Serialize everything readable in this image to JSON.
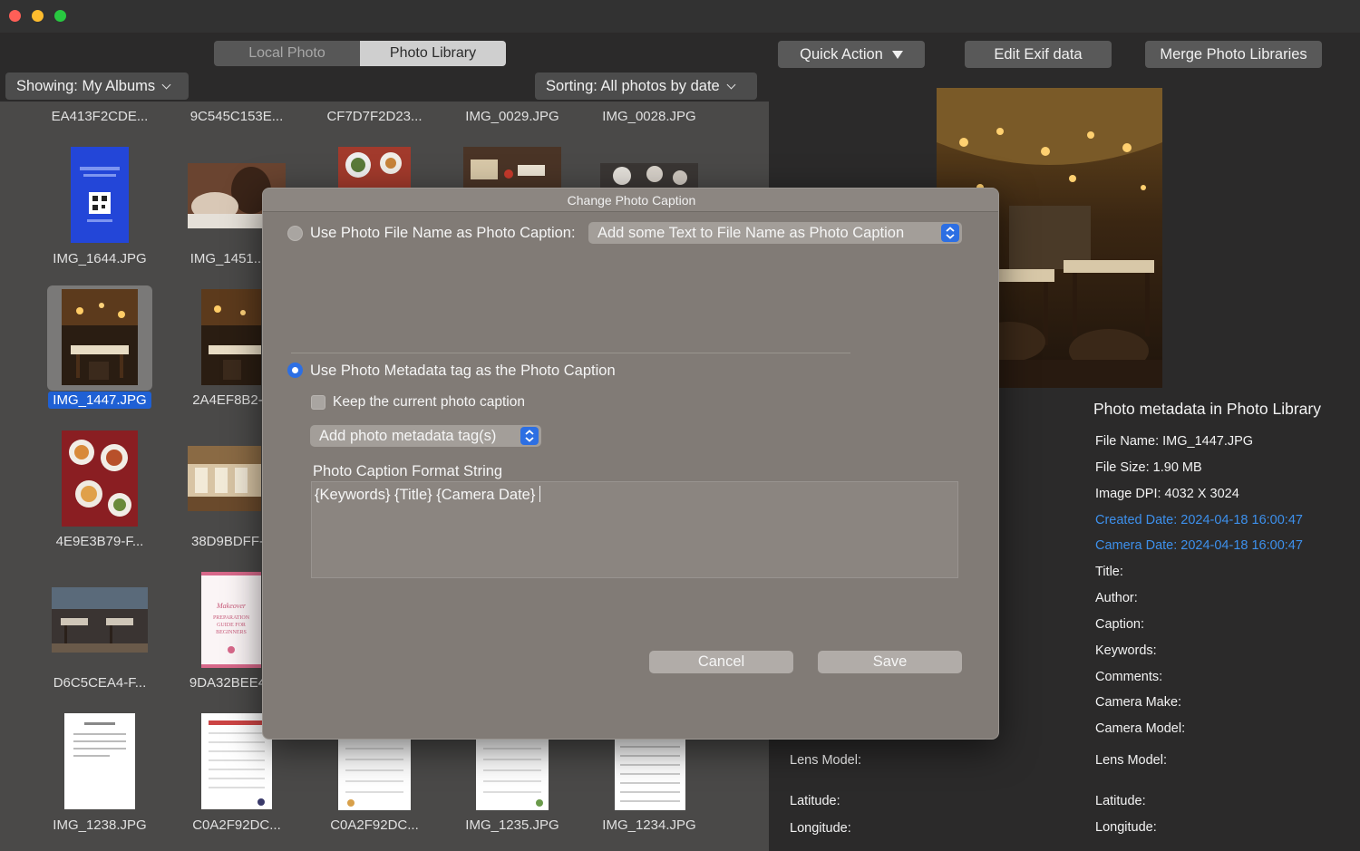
{
  "window": {
    "traffic_lights": [
      "close",
      "minimize",
      "zoom"
    ]
  },
  "toolbar": {
    "segments": [
      "Local Photo",
      "Photo Library"
    ],
    "quick_action": "Quick Action",
    "edit_exif": "Edit Exif data",
    "merge": "Merge Photo Libraries"
  },
  "filters": {
    "showing": "Showing: My Albums",
    "sorting": "Sorting: All photos by date"
  },
  "grid": {
    "row0": [
      "EA413F2CDE...",
      "9C545C153E...",
      "CF7D7F2D23...",
      "IMG_0029.JPG",
      "IMG_0028.JPG"
    ],
    "col0": [
      "IMG_1644.JPG",
      "IMG_1447.JPG",
      "4E9E3B79-F...",
      "D6C5CEA4-F...",
      "IMG_1238.JPG"
    ],
    "col1": [
      "IMG_1451...",
      "2A4EF8B2-",
      "38D9BDFF-",
      "9DA32BEE4",
      "C0A2F92DC..."
    ],
    "bottom_rest": [
      "C0A2F92DC...",
      "IMG_1235.JPG",
      "IMG_1234.JPG"
    ],
    "doc_text": "PREPARATION GUIDE FOR BEGINNERS"
  },
  "dialog": {
    "title": "Change Photo Caption",
    "option_filename": "Use Photo File Name as Photo Caption:",
    "filename_popup": "Add some Text to File Name as Photo Caption",
    "option_metadata": "Use Photo Metadata tag as the Photo Caption",
    "keep_caption": "Keep the current photo caption",
    "metadata_popup": "Add photo metadata tag(s)",
    "format_label": "Photo Caption Format String",
    "format_value": "{Keywords} {Title} {Camera Date}",
    "cancel": "Cancel",
    "save": "Save"
  },
  "metadata": {
    "title": "Photo metadata in Photo Library",
    "file_name": "File Name: IMG_1447.JPG",
    "file_size": "File Size: 1.90 MB",
    "dpi": "Image DPI: 4032 X 3024",
    "created": "Created Date: 2024-04-18 16:00:47",
    "camera_date": "Camera Date: 2024-04-18 16:00:47",
    "title_field": "Title:",
    "author": "Author:",
    "caption": "Caption:",
    "keywords": "Keywords:",
    "comments": "Comments:",
    "camera_make": "Camera Make:",
    "camera_model": "Camera Model:",
    "lens_model": "Lens Model:",
    "latitude": "Latitude:",
    "longitude": "Longitude:",
    "left_lens_model": "Lens Model:",
    "left_latitude": "Latitude:",
    "left_longitude": "Longitude:"
  },
  "colors": {
    "accent": "#2d6fe3",
    "link": "#3d90ec",
    "selection": "#1f60d4"
  }
}
